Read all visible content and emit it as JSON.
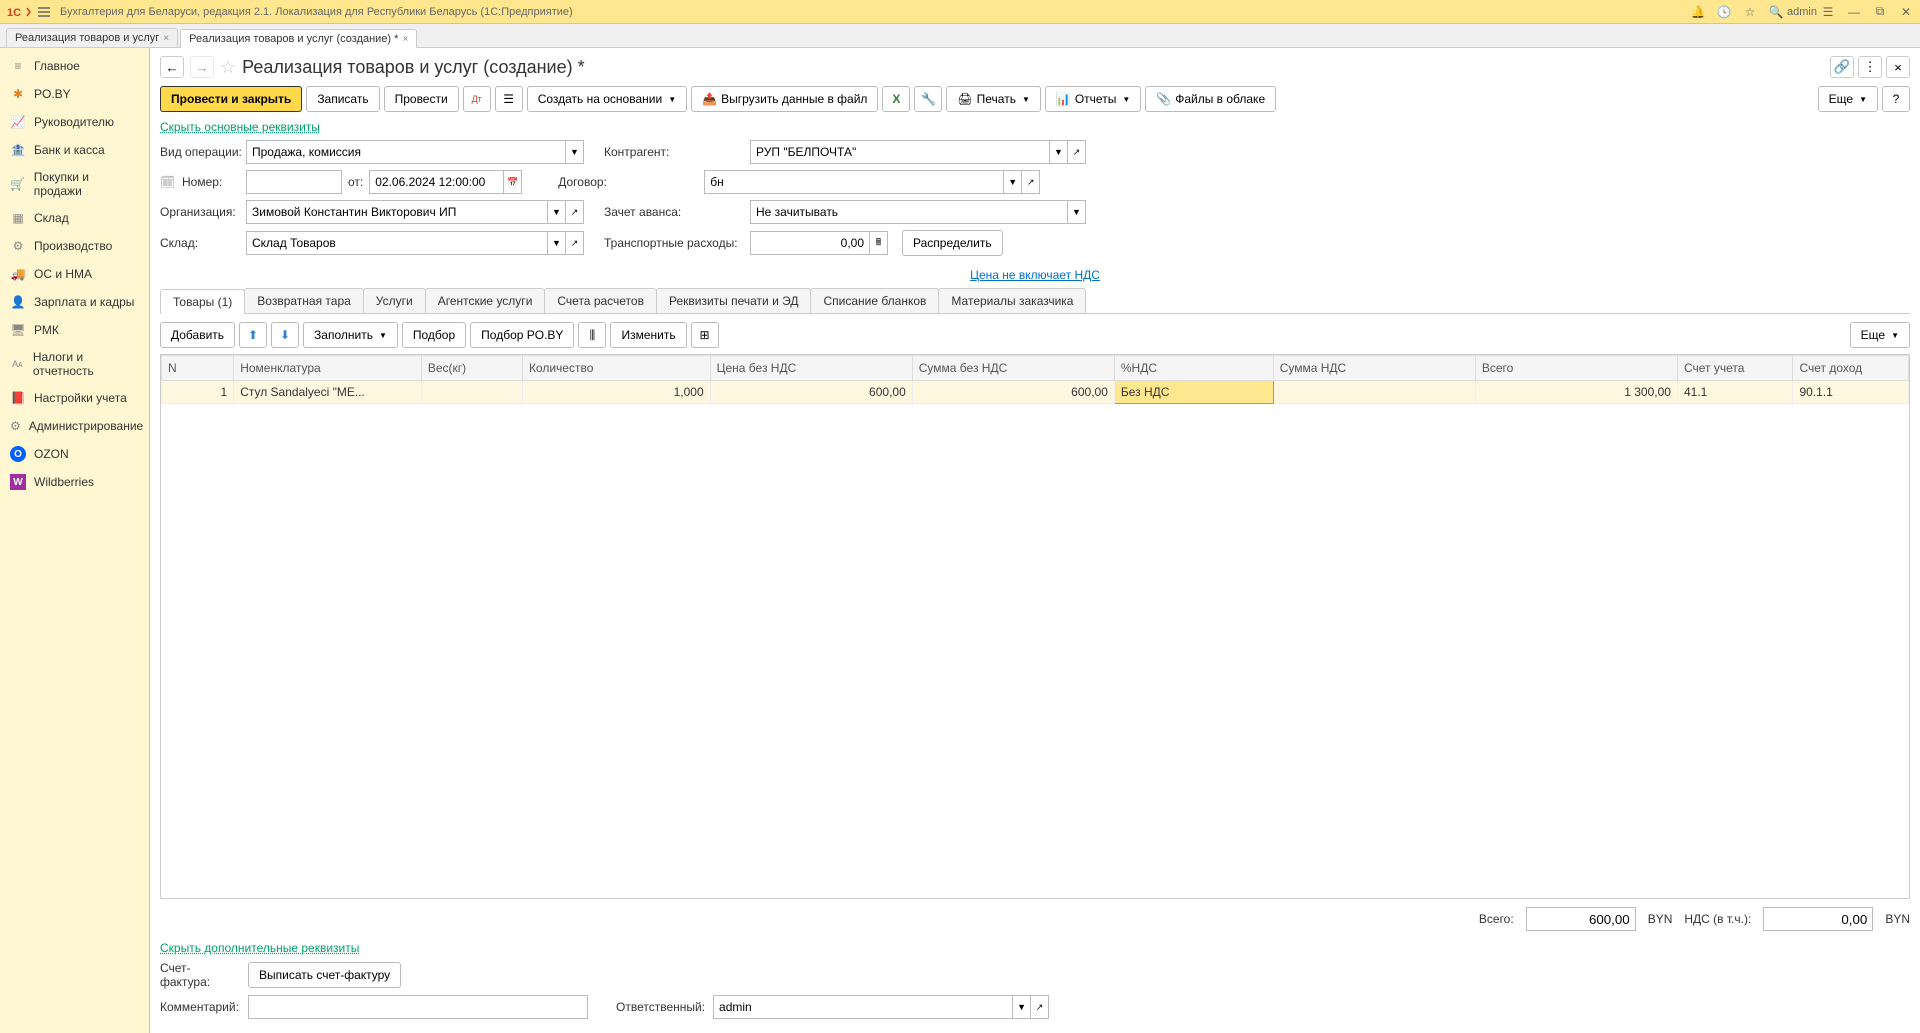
{
  "title_bar": {
    "app_title": "Бухгалтерия для Беларуси, редакция 2.1. Локализация для Республики Беларусь   (1С:Предприятие)",
    "user": "admin"
  },
  "tabs": [
    {
      "label": "Реализация товаров и услуг",
      "active": false
    },
    {
      "label": "Реализация товаров и услуг (создание) *",
      "active": true
    }
  ],
  "sidebar": {
    "items": [
      {
        "label": "Главное",
        "icon": "≡"
      },
      {
        "label": "PO.BY",
        "icon": "✱",
        "color": "#e08020"
      },
      {
        "label": "Руководителю",
        "icon": "↗"
      },
      {
        "label": "Банк и касса",
        "icon": "●"
      },
      {
        "label": "Покупки и продажи",
        "icon": "🛒"
      },
      {
        "label": "Склад",
        "icon": "▦"
      },
      {
        "label": "Производство",
        "icon": "⚙"
      },
      {
        "label": "ОС и НМА",
        "icon": "🚚"
      },
      {
        "label": "Зарплата и кадры",
        "icon": "👤"
      },
      {
        "label": "РМК",
        "icon": "🖥"
      },
      {
        "label": "Налоги и отчетность",
        "icon": "Ao"
      },
      {
        "label": "Настройки учета",
        "icon": "📕"
      },
      {
        "label": "Администрирование",
        "icon": "⚙"
      },
      {
        "label": "OZON",
        "icon": "O",
        "color": "#0060ff"
      },
      {
        "label": "Wildberries",
        "icon": "W",
        "color": "#a030a0"
      }
    ]
  },
  "page": {
    "title": "Реализация товаров и услуг (создание) *",
    "hide_main_link": "Скрыть основные реквизиты",
    "hide_extra_link": "Скрыть дополнительные реквизиты",
    "vat_link": "Цена не включает НДС"
  },
  "toolbar": {
    "post_close": "Провести и закрыть",
    "save": "Записать",
    "post": "Провести",
    "create_based": "Создать на основании",
    "export_file": "Выгрузить данные в файл",
    "print": "Печать",
    "reports": "Отчеты",
    "cloud_files": "Файлы в облаке",
    "more": "Еще"
  },
  "form": {
    "operation_label": "Вид операции:",
    "operation_value": "Продажа, комиссия",
    "number_label": "Номер:",
    "number_value": "",
    "from_label": "от:",
    "date_value": "02.06.2024 12:00:00",
    "org_label": "Организация:",
    "org_value": "Зимовой Константин Викторович ИП",
    "warehouse_label": "Склад:",
    "warehouse_value": "Склад Товаров",
    "contractor_label": "Контрагент:",
    "contractor_value": "РУП \"БЕЛПОЧТА\"",
    "contract_label": "Договор:",
    "contract_value": "бн",
    "advance_label": "Зачет аванса:",
    "advance_value": "Не зачитывать",
    "transport_label": "Транспортные расходы:",
    "transport_value": "0,00",
    "distribute": "Распределить"
  },
  "inner_tabs": [
    "Товары (1)",
    "Возвратная тара",
    "Услуги",
    "Агентские услуги",
    "Счета расчетов",
    "Реквизиты печати и ЭД",
    "Списание бланков",
    "Материалы заказчика"
  ],
  "tab_toolbar": {
    "add": "Добавить",
    "fill": "Заполнить",
    "select": "Подбор",
    "select_poby": "Подбор PO.BY",
    "change": "Изменить",
    "more": "Еще"
  },
  "table": {
    "headers": [
      "N",
      "Номенклатура",
      "Вес(кг)",
      "Количество",
      "Цена без НДС",
      "Сумма без НДС",
      "%НДС",
      "Сумма НДС",
      "Всего",
      "Счет учета",
      "Счет доход"
    ],
    "rows": [
      {
        "n": "1",
        "nom": "Стул Sandalyeci \"ME...",
        "weight": "",
        "qty": "1,000",
        "price": "600,00",
        "sum": "600,00",
        "vat": "Без НДС",
        "vat_sum": "",
        "total": "1 300,00",
        "acc": "41.1",
        "acc2": "90.1.1"
      }
    ]
  },
  "totals": {
    "total_label": "Всего:",
    "total_value": "600,00",
    "currency1": "BYN",
    "vat_inc_label": "НДС (в т.ч.):",
    "vat_inc_value": "0,00",
    "currency2": "BYN"
  },
  "bottom": {
    "invoice_label": "Счет-фактура:",
    "invoice_btn": "Выписать счет-фактуру",
    "comment_label": "Комментарий:",
    "comment_value": "",
    "responsible_label": "Ответственный:",
    "responsible_value": "admin"
  }
}
